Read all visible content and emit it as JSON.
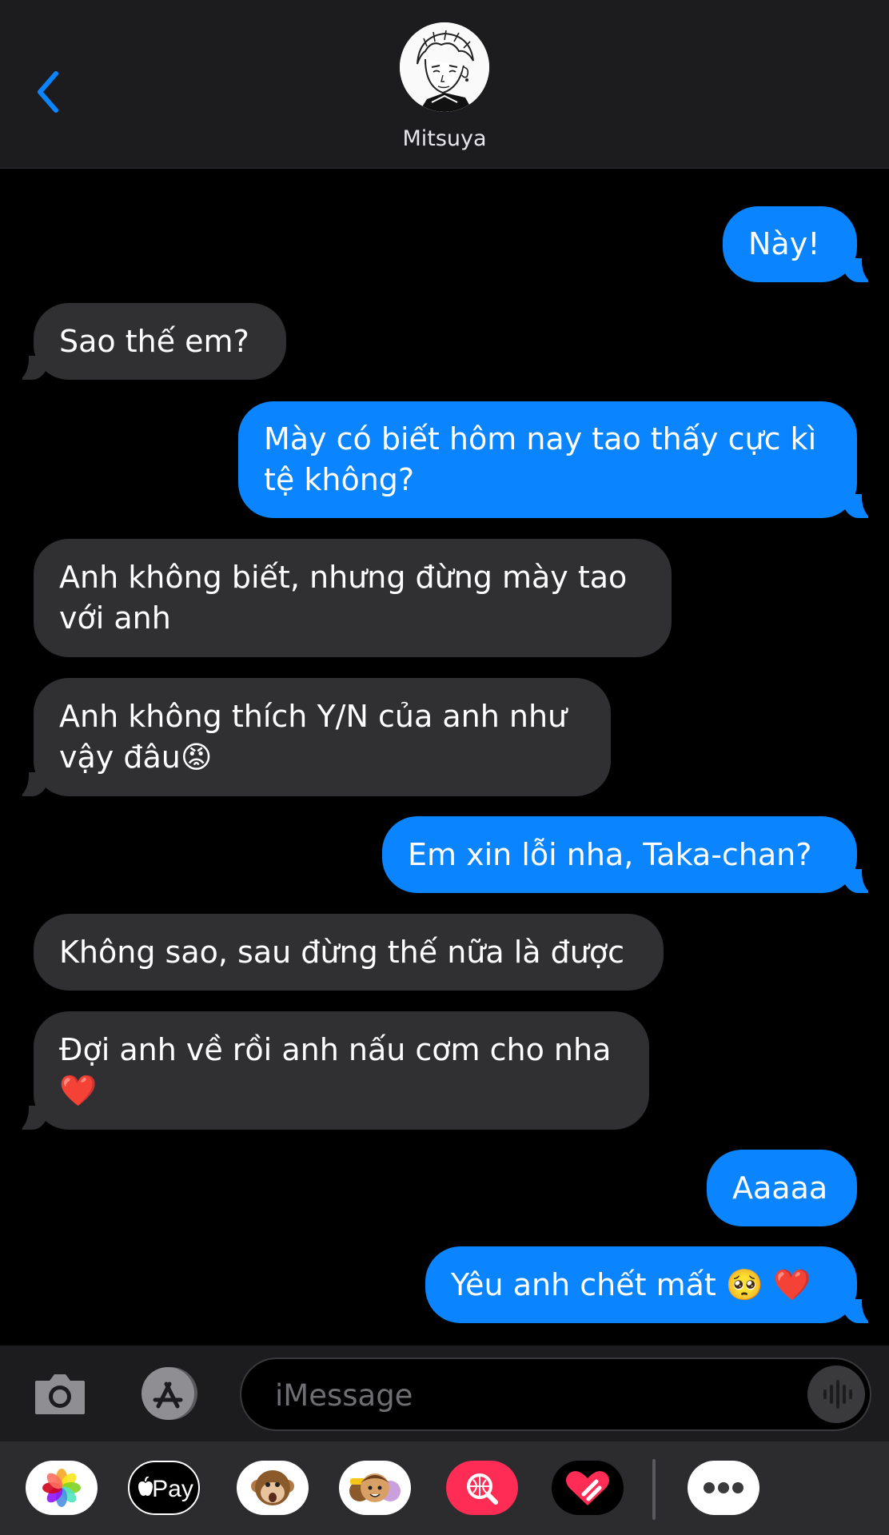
{
  "header": {
    "contact_name": "Mitsuya",
    "back_icon": "chevron-left-icon",
    "accent_color": "#0a84ff"
  },
  "messages": [
    {
      "direction": "outgoing",
      "text": "Này!"
    },
    {
      "direction": "incoming",
      "text": "Sao thế em?"
    },
    {
      "direction": "outgoing",
      "text": "Mày có biết hôm nay tao thấy cực kì tệ không?"
    },
    {
      "direction": "incoming",
      "text": "Anh không biết, nhưng đừng mày tao với anh"
    },
    {
      "direction": "incoming",
      "text": "Anh không thích Y/N của anh như vậy đâu",
      "emoji": "😡"
    },
    {
      "direction": "outgoing",
      "text": "Em xin lỗi nha, Taka-chan?"
    },
    {
      "direction": "incoming",
      "text": "Không sao, sau đừng thế nữa là được"
    },
    {
      "direction": "incoming",
      "text": "Đợi anh về rồi anh nấu cơm cho nha",
      "emoji": "❤️"
    },
    {
      "direction": "outgoing",
      "text": "Aaaaa"
    },
    {
      "direction": "outgoing",
      "text": "Yêu anh chết mất",
      "emoji": "🥺 ❤️"
    }
  ],
  "input": {
    "placeholder": "iMessage",
    "value": ""
  },
  "toolbar": {
    "camera_icon": "camera-icon",
    "appstore_icon": "app-store-icon",
    "audio_icon": "waveform-icon"
  },
  "app_drawer": {
    "apple_pay_label": "Pay",
    "apps": [
      "photos-icon",
      "apple-pay-icon",
      "animoji-icon",
      "memoji-icon",
      "images-search-icon",
      "digital-touch-icon",
      "more-icon"
    ]
  }
}
